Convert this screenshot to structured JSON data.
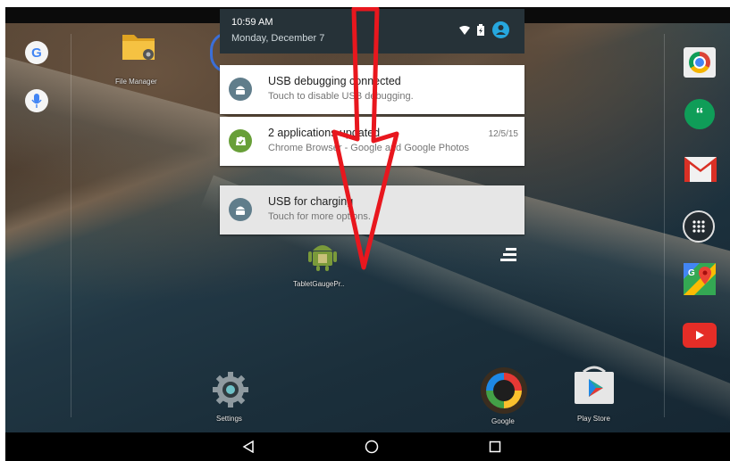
{
  "status": {
    "time": "10:59 AM",
    "date": "Monday, December 7"
  },
  "notifications": [
    {
      "title": "USB debugging connected",
      "text": "Touch to disable USB debugging.",
      "timestamp": "",
      "icon": "android-icon",
      "icon_bg": "#607d8b"
    },
    {
      "title": "2 applications updated",
      "text": "Chrome Browser - Google and Google Photos",
      "timestamp": "12/5/15",
      "icon": "store-update-icon",
      "icon_bg": "#689f38"
    },
    {
      "title": "USB for charging",
      "text": "Touch for more options.",
      "timestamp": "",
      "icon": "android-icon",
      "icon_bg": "#607d8b"
    }
  ],
  "home": {
    "file_manager": "File Manager",
    "tablet_app": "TabletGaugePr..",
    "settings": "Settings",
    "google": "Google",
    "play_store": "Play Store"
  },
  "dock_icons": [
    "google-search-icon",
    "mic-icon",
    "chrome-icon",
    "hangouts-icon",
    "gmail-icon",
    "all-apps-icon",
    "maps-icon",
    "youtube-icon"
  ],
  "nav": [
    "back-icon",
    "home-icon",
    "recents-icon"
  ],
  "colors": {
    "arrow": "#e8171e",
    "status_bar": "#263238",
    "accent": "#26a7de"
  }
}
